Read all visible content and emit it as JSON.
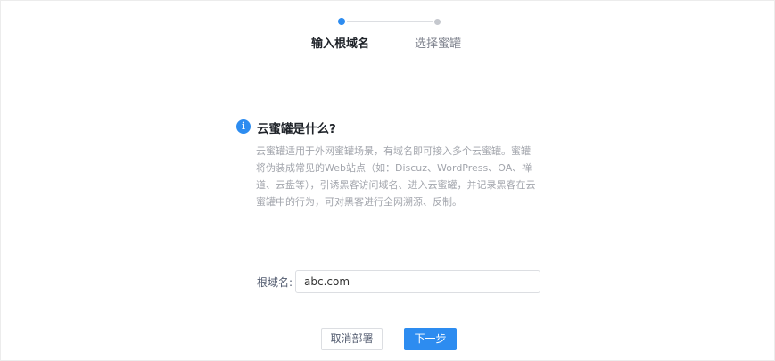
{
  "stepper": {
    "steps": [
      {
        "label": "输入根域名",
        "state": "active"
      },
      {
        "label": "选择蜜罐",
        "state": "inactive"
      }
    ]
  },
  "info": {
    "icon": "info-icon",
    "icon_glyph": "i",
    "title": "云蜜罐是什么?",
    "description": "云蜜罐适用于外网蜜罐场景，有域名即可接入多个云蜜罐。蜜罐将伪装成常见的Web站点（如：Discuz、WordPress、OA、禅道、云盘等），引诱黑客访问域名、进入云蜜罐，并记录黑客在云蜜罐中的行为，可对黑客进行全网溯源、反制。"
  },
  "form": {
    "root_domain_label": "根域名:",
    "root_domain_value": "abc.com"
  },
  "buttons": {
    "cancel_label": "取消部署",
    "next_label": "下一步"
  },
  "colors": {
    "accent": "#2d8cf0",
    "inactive_dot": "#c5c8ce",
    "desc_text": "#a3a6ad"
  }
}
